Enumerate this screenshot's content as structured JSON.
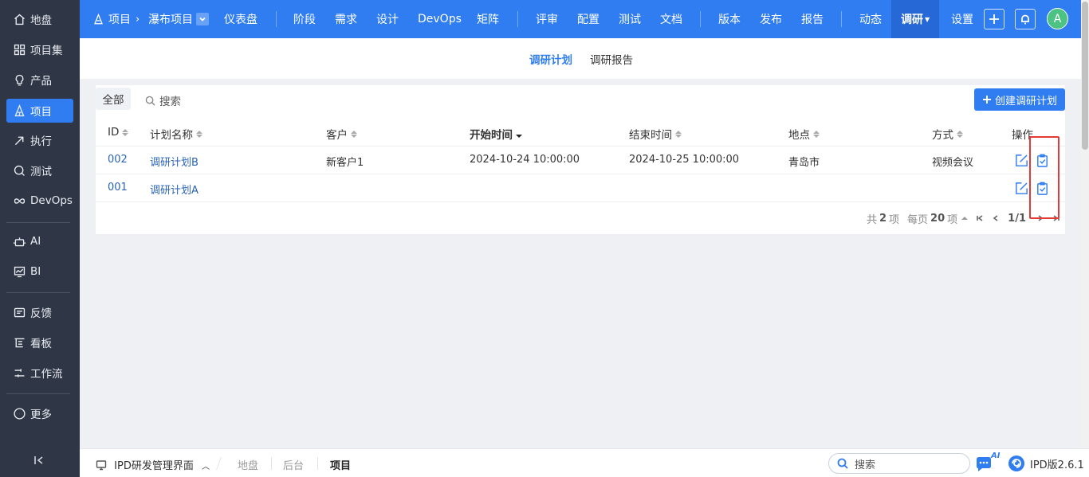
{
  "sidebar": {
    "items": [
      {
        "label": "地盘",
        "icon": "home-icon"
      },
      {
        "label": "项目集",
        "icon": "grid-icon"
      },
      {
        "label": "产品",
        "icon": "bulb-icon"
      },
      {
        "label": "项目",
        "icon": "project-icon"
      },
      {
        "label": "执行",
        "icon": "run-icon"
      },
      {
        "label": "测试",
        "icon": "test-icon"
      },
      {
        "label": "DevOps",
        "icon": "infinity-icon"
      },
      {
        "label": "AI",
        "icon": "robot-icon"
      },
      {
        "label": "BI",
        "icon": "chart-icon"
      },
      {
        "label": "反馈",
        "icon": "feedback-icon"
      },
      {
        "label": "看板",
        "icon": "kanban-icon"
      },
      {
        "label": "工作流",
        "icon": "workflow-icon"
      },
      {
        "label": "更多",
        "icon": "more-icon"
      }
    ],
    "active_index": 3
  },
  "topbar": {
    "crumb_root": "项目",
    "crumb_project": "瀑布项目",
    "nav": [
      "仪表盘",
      "阶段",
      "需求",
      "设计",
      "DevOps",
      "矩阵",
      "评审",
      "配置",
      "测试",
      "文档",
      "版本",
      "发布",
      "报告",
      "动态",
      "调研",
      "设置"
    ],
    "active": "调研",
    "avatar_letter": "A"
  },
  "subtabs": [
    "调研计划",
    "调研报告"
  ],
  "toolbar": {
    "filter_all": "全部",
    "search_label": "搜索",
    "create_label": "创建调研计划"
  },
  "table": {
    "columns": [
      "ID",
      "计划名称",
      "客户",
      "开始时间",
      "结束时间",
      "地点",
      "方式",
      "操作"
    ],
    "rows": [
      {
        "id": "002",
        "name": "调研计划B",
        "customer": "新客户1",
        "start": "2024-10-24 10:00:00",
        "end": "2024-10-25 10:00:00",
        "location": "青岛市",
        "method": "视频会议"
      },
      {
        "id": "001",
        "name": "调研计划A",
        "customer": "",
        "start": "",
        "end": "",
        "location": "",
        "method": ""
      }
    ]
  },
  "pager": {
    "total_prefix": "共",
    "total": "2",
    "total_suffix": "项",
    "per_page_prefix": "每页",
    "per_page": "20",
    "per_page_suffix": "项",
    "page": "1/1"
  },
  "bottombar": {
    "app_name": "IPD研发管理界面",
    "crumbs": [
      "地盘",
      "后台",
      "项目"
    ],
    "search_label": "搜索",
    "ai_badge": "AI",
    "version": "IPD版2.6.1"
  },
  "colors": {
    "primary": "#2f7df1",
    "sidebar_bg": "#2f3746",
    "highlight": "#e53935",
    "avatar": "#4cc283"
  }
}
